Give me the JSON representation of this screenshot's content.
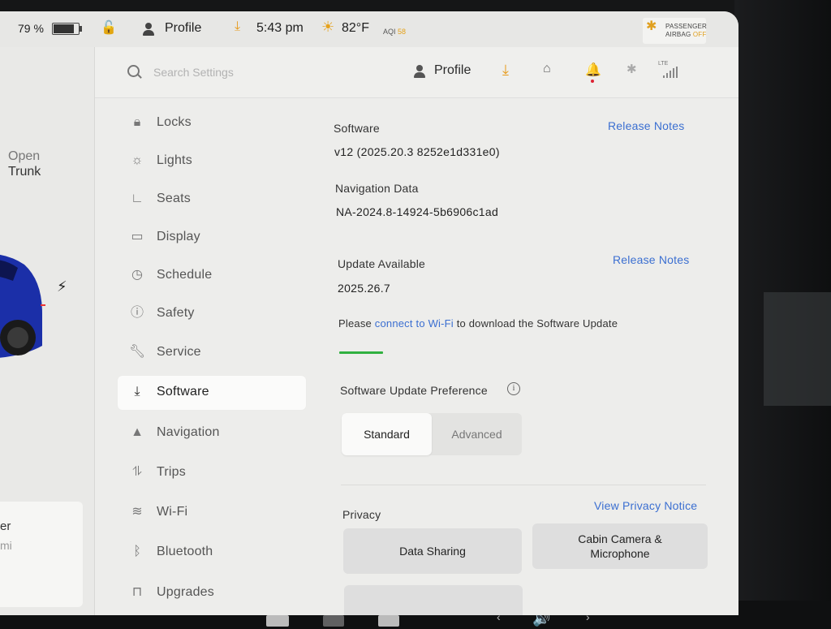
{
  "status_bar": {
    "battery_percent": "79 %",
    "profile_label": "Profile",
    "time": "5:43 pm",
    "temperature": "82°F",
    "aqi_label": "AQI",
    "aqi_value": "58",
    "airbag_line1": "PASSENGER",
    "airbag_line2": "AIRBAG",
    "airbag_state": "OFF"
  },
  "vehicle": {
    "trunk_state": "Open",
    "trunk_label": "Trunk",
    "card_line1": "er",
    "card_line2": "mi"
  },
  "header": {
    "search_placeholder": "Search Settings",
    "profile_label": "Profile",
    "lte_label": "LTE"
  },
  "menu": {
    "items": [
      {
        "label": "Locks",
        "icon": "lock-icon"
      },
      {
        "label": "Lights",
        "icon": "sun-icon"
      },
      {
        "label": "Seats",
        "icon": "seat-icon"
      },
      {
        "label": "Display",
        "icon": "display-icon"
      },
      {
        "label": "Schedule",
        "icon": "clock-icon"
      },
      {
        "label": "Safety",
        "icon": "alert-icon"
      },
      {
        "label": "Service",
        "icon": "wrench-icon"
      },
      {
        "label": "Software",
        "icon": "download-icon"
      },
      {
        "label": "Navigation",
        "icon": "navigation-icon"
      },
      {
        "label": "Trips",
        "icon": "trips-icon"
      },
      {
        "label": "Wi-Fi",
        "icon": "wifi-icon"
      },
      {
        "label": "Bluetooth",
        "icon": "bluetooth-icon"
      },
      {
        "label": "Upgrades",
        "icon": "bag-icon"
      }
    ],
    "active": "Software"
  },
  "software": {
    "title": "Software",
    "release_notes_label": "Release Notes",
    "version": "v12 (2025.20.3 8252e1d331e0)",
    "nav_title": "Navigation Data",
    "nav_version": "NA-2024.8-14924-5b6906c1ad",
    "update_title": "Update Available",
    "update_release_notes_label": "Release Notes",
    "update_version": "2025.26.7",
    "wifi_prefix": "Please",
    "wifi_link": "connect to Wi-Fi",
    "wifi_suffix": "to download the Software Update",
    "preference_title": "Software Update Preference",
    "preference_options": [
      "Standard",
      "Advanced"
    ],
    "preference_selected": "Standard",
    "privacy_title": "Privacy",
    "privacy_link": "View Privacy Notice",
    "data_sharing_label": "Data Sharing",
    "cabin_camera_label": "Cabin Camera & Microphone"
  },
  "colors": {
    "link": "#3b6fd1",
    "progress": "#30b040",
    "download_accent": "#e79a1a"
  }
}
